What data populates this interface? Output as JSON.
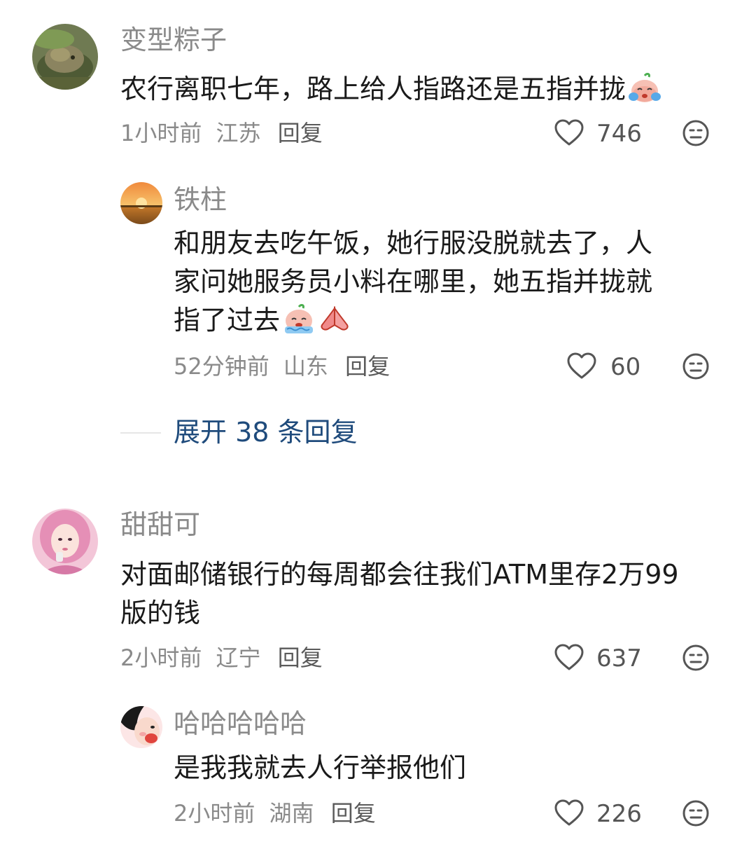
{
  "comments": [
    {
      "username": "变型粽子",
      "text": "农行离职七年，路上给人指路还是五指并拢",
      "time": "1小时前",
      "location": "江苏",
      "reply": "回复",
      "likes": "746",
      "replies": [
        {
          "username": "铁柱",
          "text_lines": [
            "和朋友去吃午饭，她行服没脱就去了，人",
            "家问她服务员小料在哪里，她五指并拢就",
            "指了过去"
          ],
          "time": "52分钟前",
          "location": "山东",
          "reply": "回复",
          "likes": "60"
        }
      ],
      "expand_label": "展开 38 条回复"
    },
    {
      "username": "甜甜可",
      "text_lines": [
        "对面邮储银行的每周都会往我们ATM里存2万99",
        "版的钱"
      ],
      "time": "2小时前",
      "location": "辽宁",
      "reply": "回复",
      "likes": "637",
      "replies": [
        {
          "username": "哈哈哈哈哈",
          "text": "是我我就去人行举报他们",
          "time": "2小时前",
          "location": "湖南",
          "reply": "回复",
          "likes": "226"
        }
      ]
    }
  ],
  "icons": {
    "like": "heart-outline-icon",
    "dislike": "neutral-face-icon",
    "emoji_crying": "crying-peach-emoji-icon",
    "emoji_sobbing": "sobbing-peach-emoji-icon",
    "emoji_pray": "praying-hands-emoji-icon"
  },
  "colors": {
    "username": "#8a8a8a",
    "text": "#1a1a1a",
    "meta": "#8a8a8a",
    "expand": "#1f4b7c"
  }
}
